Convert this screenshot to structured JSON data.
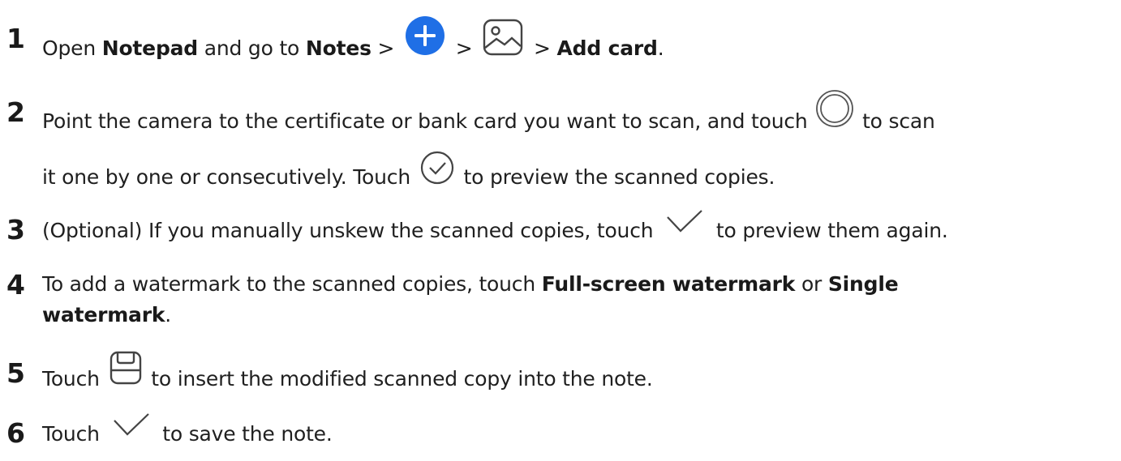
{
  "steps": [
    {
      "number": "1",
      "parts": [
        "Open ",
        "Notepad",
        " and go to ",
        "Notes",
        " > ",
        " > ",
        " > ",
        "Add card",
        "."
      ],
      "icons": [
        "plus-circle-icon",
        "image-icon"
      ]
    },
    {
      "number": "2",
      "parts": [
        "Point the camera to the certificate or bank card you want to scan, and touch ",
        " to scan",
        "it one by one or consecutively. Touch ",
        " to preview the scanned copies."
      ],
      "icons": [
        "shutter-icon",
        "check-circle-icon"
      ]
    },
    {
      "number": "3",
      "parts": [
        "(Optional) If you manually unskew the scanned copies, touch ",
        " to preview them again."
      ],
      "icons": [
        "checkmark-icon"
      ]
    },
    {
      "number": "4",
      "parts": [
        "To add a watermark to the scanned copies, touch ",
        "Full-screen watermark",
        " or ",
        "Single",
        "watermark",
        "."
      ]
    },
    {
      "number": "5",
      "parts": [
        "Touch ",
        " to insert the modified scanned copy into the note."
      ],
      "icons": [
        "save-icon"
      ]
    },
    {
      "number": "6",
      "parts": [
        "Touch ",
        " to save the note."
      ],
      "icons": [
        "checkmark-icon"
      ]
    }
  ],
  "colors": {
    "accent": "#1f6fe6",
    "text": "#1f1f1f"
  }
}
